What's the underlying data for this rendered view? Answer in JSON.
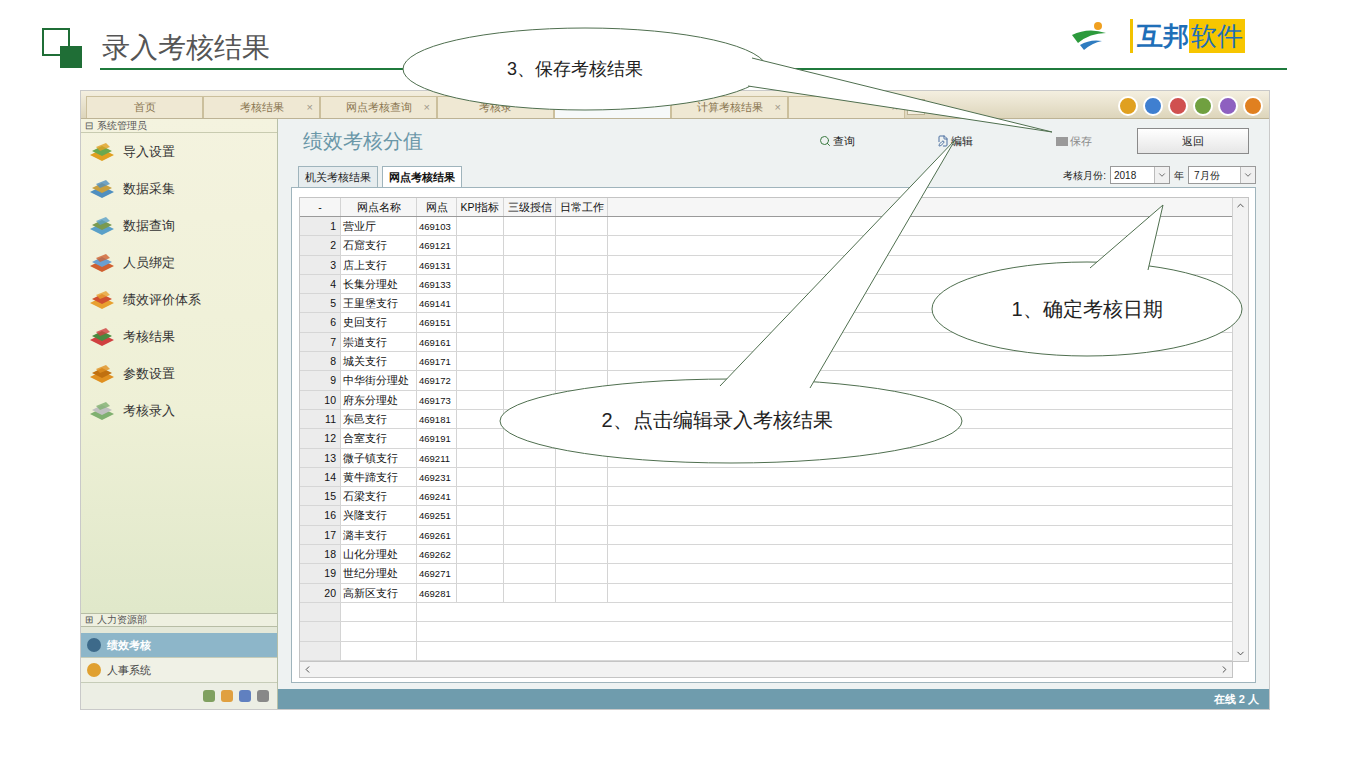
{
  "slide": {
    "title": "录入考核结果",
    "logo": {
      "brand": "互邦",
      "suffix": "软件"
    }
  },
  "tabs": [
    {
      "label": "首页",
      "closable": false,
      "selected": false
    },
    {
      "label": "考核结果",
      "closable": true,
      "selected": false
    },
    {
      "label": "网点考核查询",
      "closable": true,
      "selected": false
    },
    {
      "label": "考核录",
      "closable": false,
      "selected": false
    },
    {
      "label": "",
      "closable": false,
      "selected": true
    },
    {
      "label": "计算考核结果",
      "closable": true,
      "selected": false
    },
    {
      "label": "",
      "closable": true,
      "selected": false
    }
  ],
  "tab_close": "×",
  "sidebar": {
    "group": "系统管理员",
    "group_toggle": "⊟",
    "items": [
      "导入设置",
      "数据采集",
      "数据查询",
      "人员绑定",
      "绩效评价体系",
      "考核结果",
      "参数设置",
      "考核录入"
    ],
    "footer_group": "人力资源部",
    "footer_toggle": "⊞",
    "modules": [
      {
        "label": "绩效考核",
        "selected": true
      },
      {
        "label": "人事系统",
        "selected": false
      }
    ]
  },
  "page": {
    "title": "绩效考核分值",
    "toolbar": [
      {
        "label": "查询",
        "disabled": false
      },
      {
        "label": "编辑",
        "disabled": false
      },
      {
        "label": "保存",
        "disabled": true
      }
    ],
    "back": "返回",
    "subtabs": [
      {
        "label": "机关考核结果",
        "selected": false
      },
      {
        "label": "网点考核结果",
        "selected": true
      }
    ],
    "period": {
      "label": "考核月份:",
      "year": "2018",
      "year_unit": "年",
      "month": "7月份"
    }
  },
  "table": {
    "columns": [
      "-",
      "网点名称",
      "网点",
      "KPI指标",
      "三级授信",
      "日常工作"
    ],
    "rows": [
      {
        "index": "1",
        "name": "营业厅",
        "code": "469103"
      },
      {
        "index": "2",
        "name": "石窟支行",
        "code": "469121"
      },
      {
        "index": "3",
        "name": "店上支行",
        "code": "469131"
      },
      {
        "index": "4",
        "name": "长集分理处",
        "code": "469133"
      },
      {
        "index": "5",
        "name": "王里堡支行",
        "code": "469141"
      },
      {
        "index": "6",
        "name": "史回支行",
        "code": "469151"
      },
      {
        "index": "7",
        "name": "崇道支行",
        "code": "469161"
      },
      {
        "index": "8",
        "name": "城关支行",
        "code": "469171"
      },
      {
        "index": "9",
        "name": "中华街分理处",
        "code": "469172"
      },
      {
        "index": "10",
        "name": "府东分理处",
        "code": "469173"
      },
      {
        "index": "11",
        "name": "东邑支行",
        "code": "469181"
      },
      {
        "index": "12",
        "name": "合室支行",
        "code": "469191"
      },
      {
        "index": "13",
        "name": "微子镇支行",
        "code": "469211"
      },
      {
        "index": "14",
        "name": "黄牛蹄支行",
        "code": "469231"
      },
      {
        "index": "15",
        "name": "石梁支行",
        "code": "469241"
      },
      {
        "index": "16",
        "name": "兴隆支行",
        "code": "469251"
      },
      {
        "index": "17",
        "name": "潞丰支行",
        "code": "469261"
      },
      {
        "index": "18",
        "name": "山化分理处",
        "code": "469262"
      },
      {
        "index": "19",
        "name": "世纪分理处",
        "code": "469271"
      },
      {
        "index": "20",
        "name": "高新区支行",
        "code": "469281"
      }
    ]
  },
  "status_bar": "在线 2 人",
  "callouts": [
    {
      "text": "1、确定考核日期"
    },
    {
      "text": "2、点击编辑录入考核结果"
    },
    {
      "text": "3、保存考核结果"
    }
  ]
}
